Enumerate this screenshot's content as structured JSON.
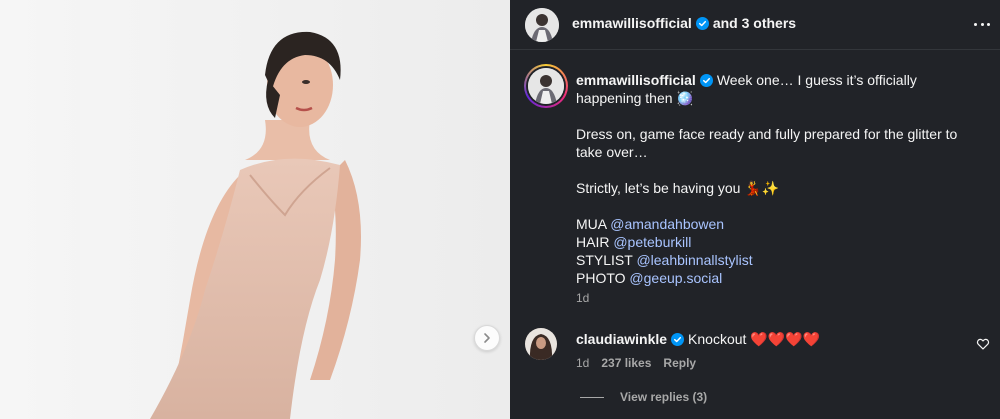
{
  "header": {
    "username": "emmawillisofficial",
    "coauthors": "and 3 others"
  },
  "post": {
    "username": "emmawillisofficial",
    "caption_line1": "Week one… I guess it’s officially",
    "caption_line2": "happening then 🪩",
    "paragraph2_line1": "Dress on, game face ready and fully prepared for the glitter to",
    "paragraph2_line2": "take over…",
    "paragraph3": "Strictly, let’s be having you 💃✨",
    "credits": [
      {
        "role": "MUA",
        "handle": "@amandahbowen"
      },
      {
        "role": "HAIR",
        "handle": "@peteburkill"
      },
      {
        "role": "STYLIST",
        "handle": "@leahbinnallstylist"
      },
      {
        "role": "PHOTO",
        "handle": "@geeup.social"
      }
    ],
    "time": "1d"
  },
  "comment": {
    "username": "claudiawinkle",
    "text": "Knockout ❤️❤️❤️❤️",
    "time": "1d",
    "likes": "237 likes",
    "reply_label": "Reply",
    "view_replies": "View replies (3)"
  },
  "colors": {
    "panel_bg": "#212328",
    "mention": "#a9c4ff",
    "verified": "#0095f6",
    "muted_text": "#a8a8a8"
  },
  "icons": {
    "verified": "verified-badge-icon",
    "more": "more-options-icon",
    "heart": "heart-icon",
    "next": "chevron-right-icon"
  }
}
